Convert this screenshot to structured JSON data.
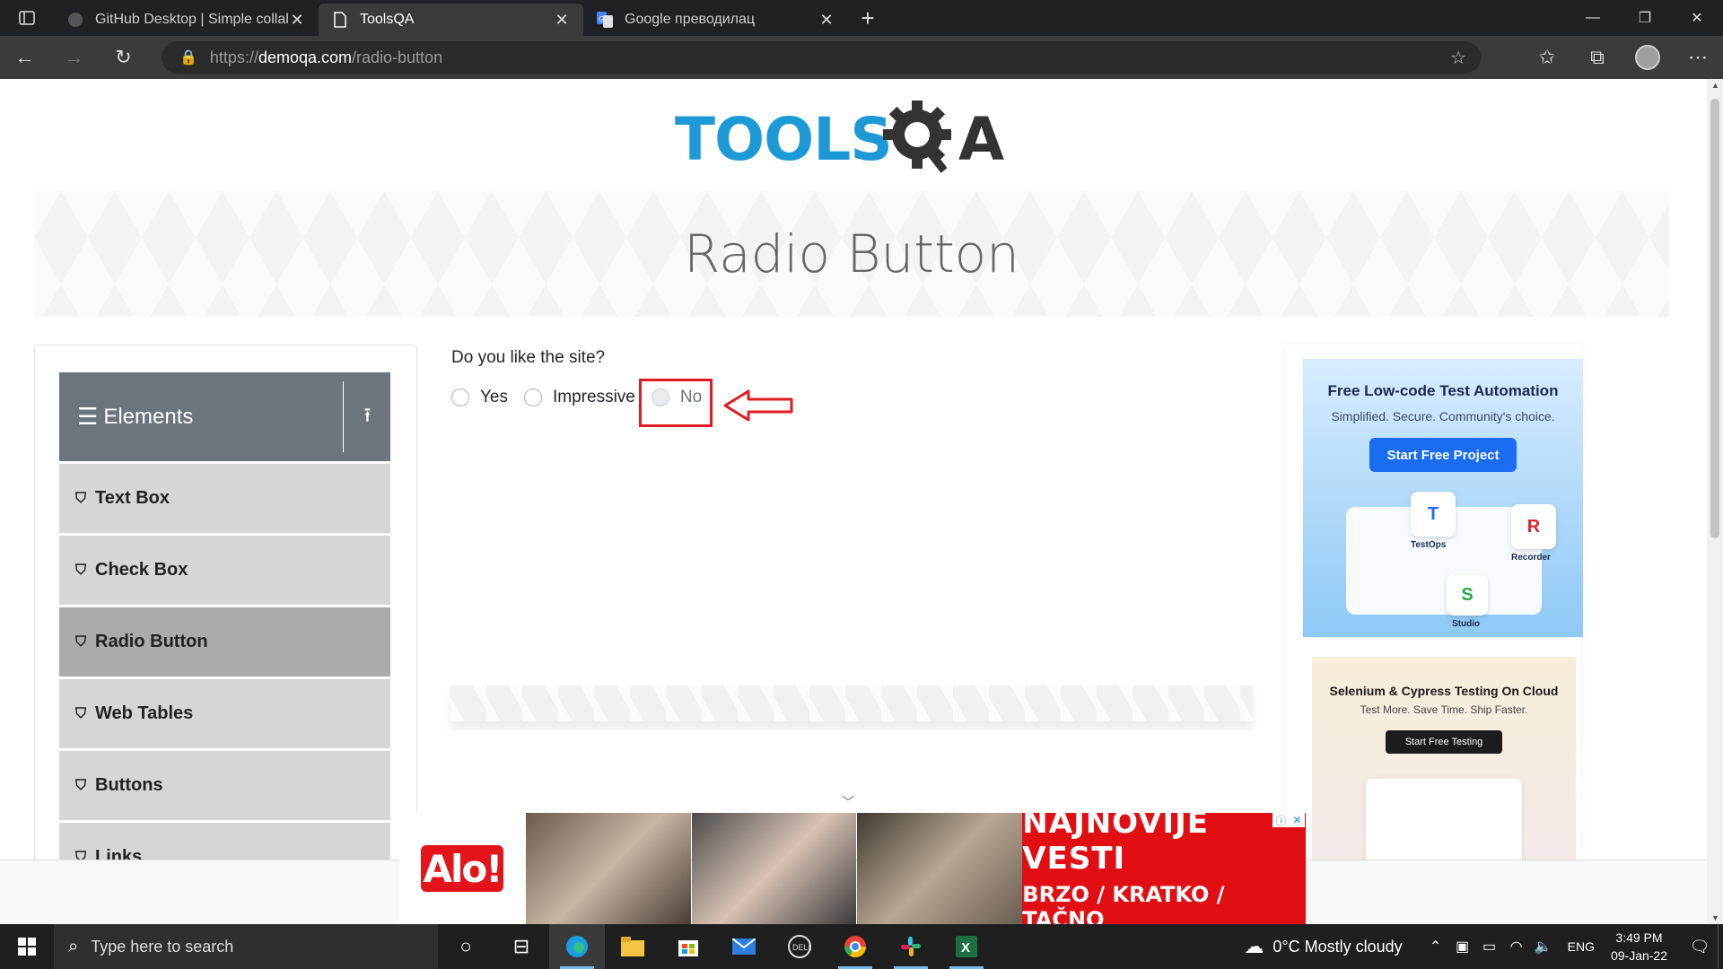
{
  "browser": {
    "tabs": [
      {
        "title": "GitHub Desktop | Simple collabo",
        "active": false
      },
      {
        "title": "ToolsQA",
        "active": true
      },
      {
        "title": "Google преводилац",
        "active": false
      }
    ],
    "url_prefix": "https://",
    "url_domain": "demoqa.com",
    "url_path": "/radio-button"
  },
  "page": {
    "banner_title": "Radio Button",
    "sidebar": {
      "group_title": "Elements",
      "items": [
        {
          "label": "Text Box"
        },
        {
          "label": "Check Box"
        },
        {
          "label": "Radio Button",
          "active": true
        },
        {
          "label": "Web Tables"
        },
        {
          "label": "Buttons"
        },
        {
          "label": "Links"
        }
      ]
    },
    "question": "Do you like the site?",
    "options": [
      {
        "label": "Yes",
        "disabled": false
      },
      {
        "label": "Impressive",
        "disabled": false
      },
      {
        "label": "No",
        "disabled": true
      }
    ]
  },
  "ads": {
    "ad1": {
      "title": "Free Low-code Test Automation",
      "subtitle": "Simplified. Secure. Community's choice.",
      "button": "Start Free Project",
      "card_testops": "TestOps",
      "card_recorder": "Recorder",
      "card_studio": "Studio"
    },
    "ad2": {
      "title": "Selenium & Cypress Testing On Cloud",
      "subtitle": "Test More. Save Time. Ship Faster.",
      "button": "Start Free Testing"
    },
    "bottom": {
      "logo": "Alo!",
      "headline": "NAJNOVIJE VESTI",
      "tagline": "BRZO / KRATKO / TAČNO"
    }
  },
  "taskbar": {
    "search_placeholder": "Type here to search",
    "weather": "0°C  Mostly cloudy",
    "lang": "ENG",
    "time": "3:49 PM",
    "date": "09-Jan-22"
  },
  "colors": {
    "highlight": "#e01b22",
    "sidebar_header": "#6c757d",
    "logo_blue": "#1d9ad6",
    "logo_dark": "#333333"
  }
}
